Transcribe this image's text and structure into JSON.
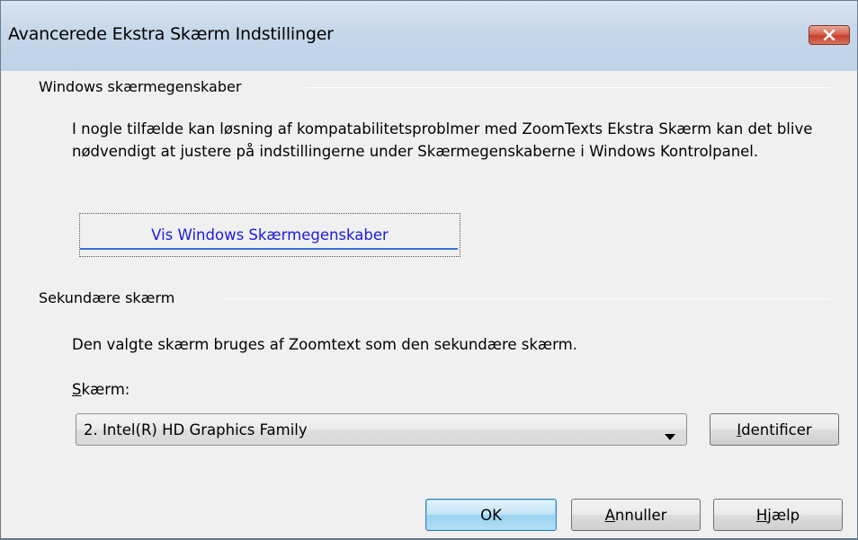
{
  "window": {
    "title": "Avancerede Ekstra Skærm Indstillinger",
    "close_icon": "close-x-icon"
  },
  "windows_section": {
    "heading": "Windows skærmegenskaber",
    "description": "I nogle tilfælde kan løsning af kompatabilitetsproblmer med ZoomTexts Ekstra Skærm kan det blive nødvendigt at justere på indstillingerne under Skærmegenskaberne i Windows Kontrolpanel.",
    "link_button_label": "Vis Windows Skærmegenskaber"
  },
  "secondary_section": {
    "heading": "Sekundære skærm",
    "info": "Den valgte skærm bruges af Zoomtext som den sekundære skærm.",
    "field_label_accel": "S",
    "field_label_rest": "kærm:",
    "selected_display": "2. Intel(R) HD Graphics Family",
    "dropdown_icon": "dropdown-arrow-icon",
    "identify_accel": "I",
    "identify_rest": "dentificer"
  },
  "footer": {
    "ok_label": "OK",
    "cancel_accel": "A",
    "cancel_rest": "nnuller",
    "help_accel": "H",
    "help_rest": "jælp"
  },
  "colors": {
    "link": "#1a1ae0",
    "titlebar": "#c6d7ea",
    "close_button": "#c2402a",
    "ok_button": "#98d1ef"
  }
}
